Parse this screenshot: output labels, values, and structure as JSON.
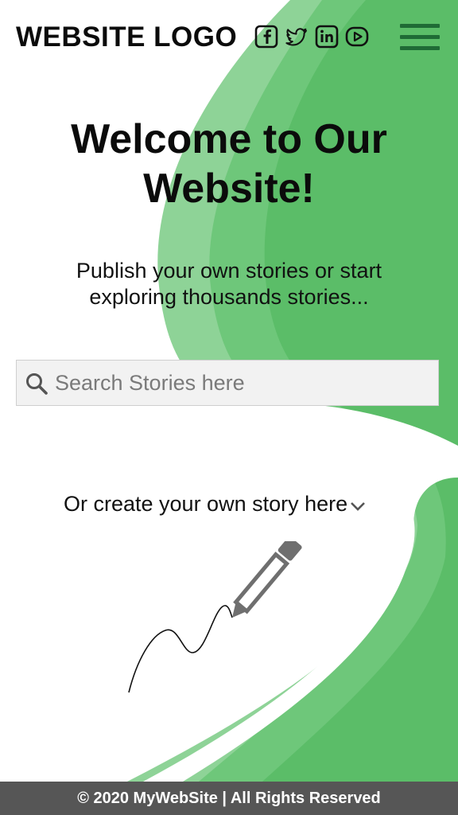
{
  "header": {
    "logo": "WEBSITE LOGO",
    "social_icons": [
      "facebook-icon",
      "twitter-icon",
      "linkedin-icon",
      "youtube-icon"
    ],
    "menu_icon": "hamburger-menu-icon"
  },
  "hero": {
    "title_line1": "Welcome to Our",
    "title_line2": "Website!",
    "subtitle": "Publish your own stories or start exploring thousands stories..."
  },
  "search": {
    "placeholder": "Search Stories here",
    "value": "",
    "icon": "search-icon"
  },
  "create": {
    "label": "Or create your own story here",
    "icon": "chevron-down-icon",
    "illustration": "pencil-icon"
  },
  "footer": {
    "text": "© 2020 MyWebSite | All Rights Reserved"
  },
  "colors": {
    "green_dark": "#5bbd68",
    "green_mid": "#6ec77a",
    "green_light": "#8ed397",
    "menu": "#1f6b35",
    "footer_bg": "#565656",
    "search_bg": "#f2f2f2"
  }
}
